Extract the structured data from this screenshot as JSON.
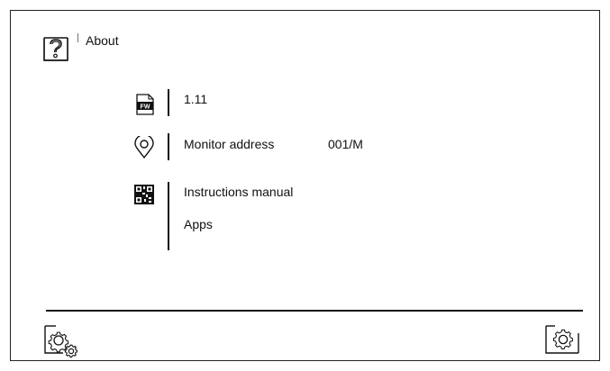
{
  "header": {
    "title": "About",
    "icon": "help-icon"
  },
  "rows": {
    "firmware": {
      "icon": "fw-icon",
      "icon_text": "FW",
      "value": "1.11"
    },
    "address": {
      "icon": "location-pin-icon",
      "label": "Monitor address",
      "value": "001/M"
    },
    "links": {
      "icon": "qr-code-icon",
      "items": [
        {
          "label": "Instructions manual"
        },
        {
          "label": "Apps"
        }
      ]
    }
  },
  "footer": {
    "left_icon": "settings-icon",
    "right_icon": "gear-icon"
  },
  "colors": {
    "line": "#111111",
    "background": "#ffffff"
  }
}
